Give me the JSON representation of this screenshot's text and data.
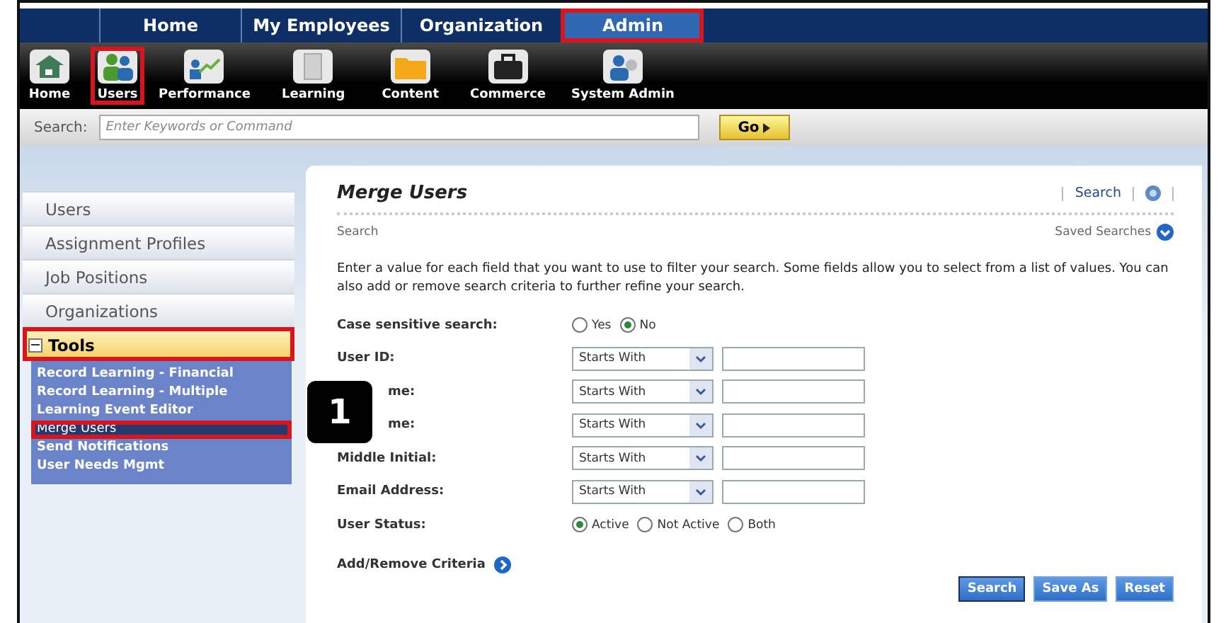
{
  "top_nav": [
    {
      "label": "Home",
      "selected": false,
      "highlighted": false
    },
    {
      "label": "My Employees",
      "selected": false,
      "highlighted": false
    },
    {
      "label": "Organization",
      "selected": false,
      "highlighted": false
    },
    {
      "label": "Admin",
      "selected": true,
      "highlighted": true
    }
  ],
  "toolbar": [
    {
      "label": "Home",
      "highlighted": false
    },
    {
      "label": "Users",
      "highlighted": true
    },
    {
      "label": "Performance",
      "highlighted": false
    },
    {
      "label": "Learning",
      "highlighted": false
    },
    {
      "label": "Content",
      "highlighted": false
    },
    {
      "label": "Commerce",
      "highlighted": false
    },
    {
      "label": "System Admin",
      "highlighted": false
    }
  ],
  "search_bar": {
    "label": "Search:",
    "placeholder": "Enter Keywords or Command",
    "button": "Go"
  },
  "sidebar": {
    "items": [
      {
        "label": "Users",
        "kind": "tab",
        "expanded": false,
        "highlighted": false
      },
      {
        "label": "Assignment Profiles",
        "kind": "tab",
        "expanded": false,
        "highlighted": false
      },
      {
        "label": "Job Positions",
        "kind": "tab",
        "expanded": false,
        "highlighted": false
      },
      {
        "label": "Organizations",
        "kind": "tab",
        "expanded": false,
        "highlighted": false
      },
      {
        "label": "Tools",
        "kind": "tab",
        "expanded": true,
        "highlighted": true,
        "children": [
          {
            "label": "Record Learning - Financial",
            "selected": false,
            "highlighted": false
          },
          {
            "label": "Record Learning - Multiple",
            "selected": false,
            "highlighted": false
          },
          {
            "label": "Learning Event Editor",
            "selected": false,
            "highlighted": false
          },
          {
            "label": "Merge Users",
            "selected": true,
            "highlighted": true
          },
          {
            "label": "Send Notifications",
            "selected": false,
            "highlighted": false
          },
          {
            "label": "User Needs Mgmt",
            "selected": false,
            "highlighted": false
          }
        ]
      }
    ]
  },
  "panel": {
    "title": "Merge Users",
    "header_link": "Search",
    "section": "Search",
    "saved_searches": "Saved Searches",
    "intro": "Enter a value for each field that you want to use to filter your search. Some fields allow you to select from a list of values. You can also add or remove search criteria to further refine your search.",
    "fields": [
      {
        "label": "Case sensitive search:",
        "kind": "radio",
        "options": [
          {
            "label": "Yes",
            "selected": false
          },
          {
            "label": "No",
            "selected": true
          }
        ]
      },
      {
        "label": "User ID:",
        "kind": "match",
        "operator": "Starts With"
      },
      {
        "label": "me:",
        "kind": "match",
        "operator": "Starts With",
        "callout_covered": true
      },
      {
        "label": "me:",
        "kind": "match",
        "operator": "Starts With",
        "callout_covered": true
      },
      {
        "label": "Middle Initial:",
        "kind": "match",
        "operator": "Starts With"
      },
      {
        "label": "Email Address:",
        "kind": "match",
        "operator": "Starts With"
      },
      {
        "label": "User Status:",
        "kind": "radio",
        "options": [
          {
            "label": "Active",
            "selected": true
          },
          {
            "label": "Not Active",
            "selected": false
          },
          {
            "label": "Both",
            "selected": false
          }
        ]
      }
    ],
    "add_remove": "Add/Remove Criteria",
    "buttons": [
      {
        "label": "Search",
        "selected": true
      },
      {
        "label": "Save As",
        "selected": false
      },
      {
        "label": "Reset",
        "selected": false
      }
    ]
  },
  "callout": "1"
}
